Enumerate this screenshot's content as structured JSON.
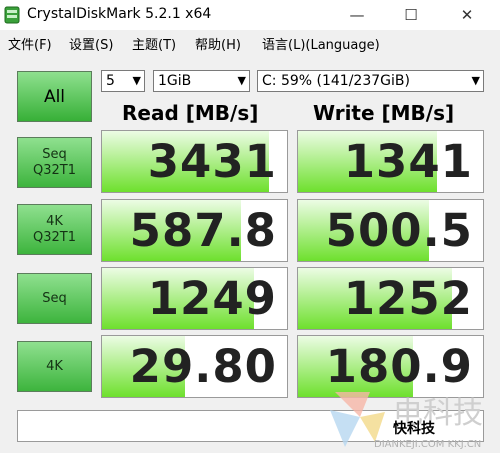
{
  "window": {
    "title": "CrystalDiskMark 5.2.1 x64",
    "minimize": "—",
    "maximize": "☐",
    "close": "✕"
  },
  "menu": [
    "文件(F)",
    "设置(S)",
    "主题(T)",
    "帮助(H)",
    "语言(L)(Language)"
  ],
  "controls": {
    "all_label": "All",
    "count": "5",
    "size": "1GiB",
    "drive": "C: 59% (141/237GiB)"
  },
  "headers": {
    "read": "Read [MB/s]",
    "write": "Write [MB/s]"
  },
  "colors": {
    "bar": "#6ee02d",
    "button": "#3db43d"
  },
  "rows": [
    {
      "label1": "Seq",
      "label2": "Q32T1",
      "read": "3431",
      "write": "1341",
      "read_fill": 0.9,
      "write_fill": 0.75
    },
    {
      "label1": "4K",
      "label2": "Q32T1",
      "read": "587.8",
      "write": "500.5",
      "read_fill": 0.75,
      "write_fill": 0.71
    },
    {
      "label1": "Seq",
      "label2": "",
      "read": "1249",
      "write": "1252",
      "read_fill": 0.82,
      "write_fill": 0.83
    },
    {
      "label1": "4K",
      "label2": "",
      "read": "29.80",
      "write": "180.9",
      "read_fill": 0.45,
      "write_fill": 0.62
    }
  ],
  "comment": "",
  "watermark": {
    "text": "电科技",
    "site": "快科技",
    "url": "DIANKEJI.COM KKJ.CN"
  }
}
